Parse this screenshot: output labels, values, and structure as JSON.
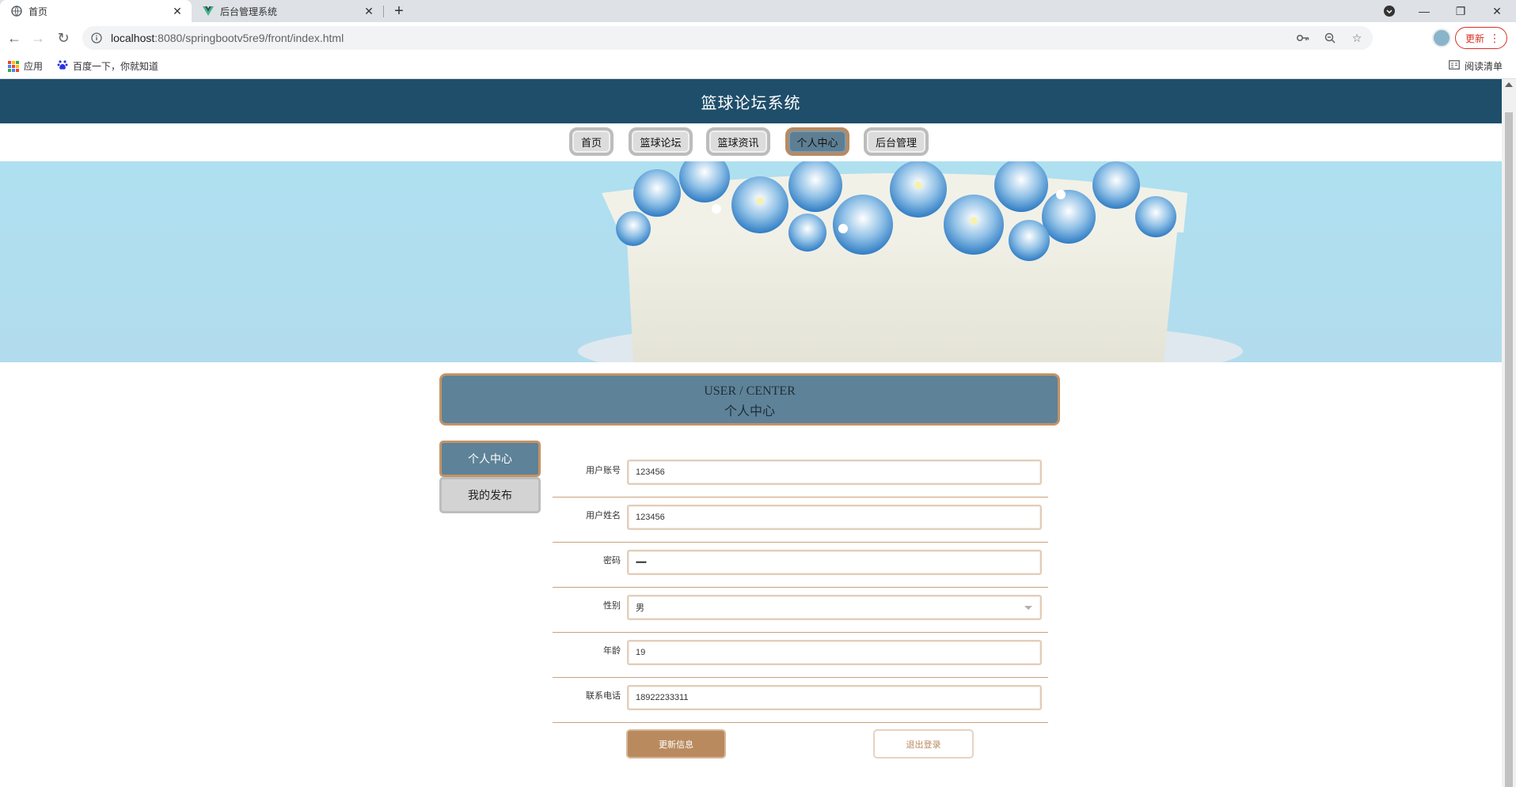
{
  "browser": {
    "tabs": [
      {
        "title": "首页",
        "icon": "globe-icon",
        "active": true
      },
      {
        "title": "后台管理系统",
        "icon": "vue-logo-icon",
        "active": false
      }
    ],
    "url_host": "localhost",
    "url_rest": ":8080/springbootv5re9/front/index.html",
    "update_label": "更新",
    "bookmarks": {
      "apps": "应用",
      "baidu": "百度一下，你就知道",
      "reading_list": "阅读清单"
    }
  },
  "site": {
    "title": "篮球论坛系统",
    "nav": [
      {
        "label": "首页",
        "active": false
      },
      {
        "label": "篮球论坛",
        "active": false
      },
      {
        "label": "篮球资讯",
        "active": false
      },
      {
        "label": "个人中心",
        "active": true
      },
      {
        "label": "后台管理",
        "active": false
      }
    ],
    "banner_image": "flower-cake-banner"
  },
  "section": {
    "title_en": "USER / CENTER",
    "title_cn": "个人中心"
  },
  "side_menu": [
    {
      "label": "个人中心",
      "active": true
    },
    {
      "label": "我的发布",
      "active": false
    }
  ],
  "form": {
    "fields": [
      {
        "label": "用户账号",
        "value": "123456"
      },
      {
        "label": "用户姓名",
        "value": "123456"
      },
      {
        "label": "密码",
        "value": "••••••"
      },
      {
        "label": "性别",
        "value": "男",
        "type": "select"
      },
      {
        "label": "年龄",
        "value": "19"
      },
      {
        "label": "联系电话",
        "value": "18922233311"
      }
    ],
    "update_button": "更新信息",
    "logout_button": "退出登录"
  },
  "colors": {
    "header": "#1f4e6a",
    "accent_blue": "#5e8298",
    "accent_tan": "#b98a5e",
    "banner_bg": "#aee0f0"
  }
}
